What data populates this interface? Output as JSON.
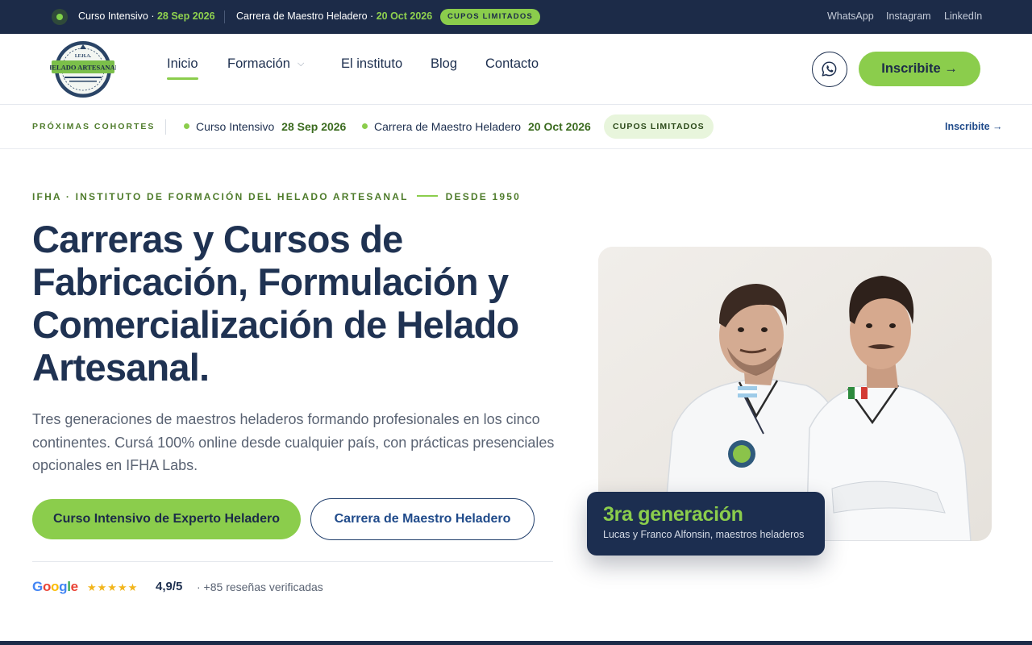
{
  "topbar": {
    "cohort1_name": "Curso Intensivo · ",
    "cohort1_date": "28 Sep 2026",
    "cohort2_name": "Carrera de Maestro Heladero · ",
    "cohort2_date": "20 Oct 2026",
    "badge": "CUPOS LIMITADOS",
    "social": [
      "WhatsApp",
      "Instagram",
      "LinkedIn"
    ]
  },
  "header": {
    "logo_text": "HELADO ARTESANAL",
    "logo_top": "I.F.H.A.",
    "nav": [
      "Inicio",
      "Formación",
      "El instituto",
      "Blog",
      "Contacto"
    ],
    "cta": "Inscribite",
    "cta_arrow": "→"
  },
  "cohorts": {
    "label": "PRÓXIMAS COHORTES",
    "items": [
      {
        "name": "Curso Intensivo",
        "date": "28 Sep 2026"
      },
      {
        "name": "Carrera de Maestro Heladero",
        "date": "20 Oct 2026"
      }
    ],
    "badge": "CUPOS LIMITADOS",
    "link": "Inscribite →"
  },
  "hero": {
    "eyebrow_left": "IFHA · INSTITUTO DE FORMACIÓN DEL HELADO ARTESANAL",
    "eyebrow_right": "DESDE 1950",
    "title": "Carreras y Cursos de Fabricación, Formulación y Comercialización de Helado Artesanal.",
    "lead": "Tres generaciones de maestros heladeros formando profesionales en los cinco continentes. Cursá 100% online desde cualquier país, con prácticas presenciales opcionales en IFHA Labs.",
    "primary_button": "Curso Intensivo de Experto Heladero",
    "secondary_button": "Carrera de Maestro Heladero",
    "rating_stars": "★★★★★",
    "rating_score": "4,9/5",
    "rating_reviews": "· +85 reseñas verificadas"
  },
  "photo_badge": {
    "title": "3ra generación",
    "subtitle": "Lucas y Franco Alfonsin, maestros heladeros"
  },
  "colors": {
    "navy": "#1c2b48",
    "accent_green": "#8bcd4c",
    "dark_green": "#4f7c2c"
  }
}
